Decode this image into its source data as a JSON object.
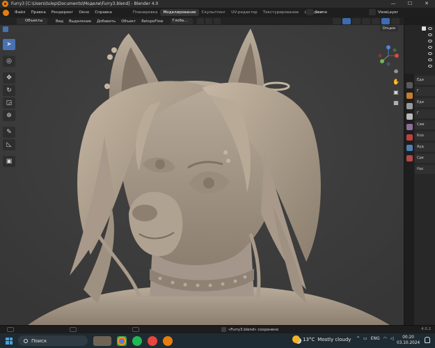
{
  "window": {
    "title": "Furry3 [C:\\Users\\tulep\\Documents\\Модели\\Furry3.blend] - Blender 4.0",
    "min": "—",
    "max": "☐",
    "close": "✕"
  },
  "menu": {
    "items": [
      "Файл",
      "Правка",
      "Рендеринг",
      "Окно",
      "Справка"
    ],
    "workspaces": [
      "Планировка",
      "Моделирование",
      "Скульптинг",
      "UV-редактор",
      "Текстурирование",
      "Шейдинг"
    ],
    "active_workspace": "Моделирование",
    "scene": "Scene",
    "view_layer": "ViewLayer"
  },
  "header": {
    "mode": "Объекты",
    "menus": [
      "Вид",
      "Выделение",
      "Добавить",
      "Объект",
      "RetopoFlow"
    ],
    "orientation": "Глоба..."
  },
  "viewport": {
    "options": "Опции"
  },
  "toolbar": {
    "tools": [
      {
        "name": "select-tool",
        "glyph": "➤"
      },
      {
        "name": "cursor-tool",
        "glyph": "◎"
      },
      {
        "name": "move-tool",
        "glyph": "✥"
      },
      {
        "name": "rotate-tool",
        "glyph": "↻"
      },
      {
        "name": "scale-tool",
        "glyph": "◲"
      },
      {
        "name": "transform-tool",
        "glyph": "⊕"
      },
      {
        "name": "annotate-tool",
        "glyph": "✎"
      },
      {
        "name": "measure-tool",
        "glyph": "◺"
      },
      {
        "name": "add-cube-tool",
        "glyph": "▣"
      }
    ]
  },
  "properties": {
    "items": [
      "Еди",
      "Г",
      "Еди",
      "Г",
      "Сим",
      "Кло",
      "Ауд",
      "Сре",
      "Нас"
    ]
  },
  "status": {
    "message": "«Furry3.blend» сохранено",
    "version": "4.0.2"
  },
  "taskbar": {
    "search_label": "Поиск",
    "weather_temp": "13°C",
    "weather_text": "Mostly cloudy",
    "lang": "ENG",
    "time": "00:20",
    "date": "03.10.2024"
  }
}
